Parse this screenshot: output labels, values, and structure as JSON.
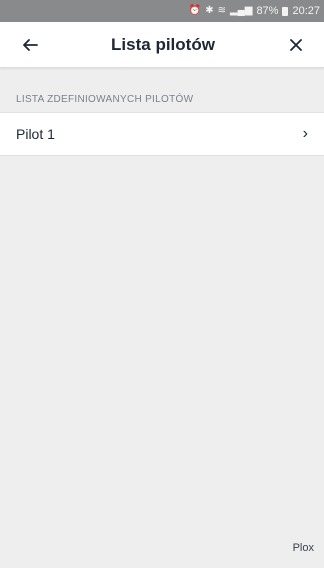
{
  "status_bar": {
    "icons": [
      "alarm-icon",
      "bluetooth-icon",
      "wifi-icon",
      "signal-icon"
    ],
    "battery": "87%",
    "time": "20:27"
  },
  "header": {
    "back_icon": "arrow-left-icon",
    "title": "Lista pilotów",
    "close_icon": "close-icon"
  },
  "section": {
    "title": "LISTA ZDEFINIOWANYCH PILOTÓW",
    "items": [
      {
        "label": "Pilot 1",
        "chevron": "›"
      }
    ]
  },
  "footer": {
    "brand": "Plox"
  }
}
